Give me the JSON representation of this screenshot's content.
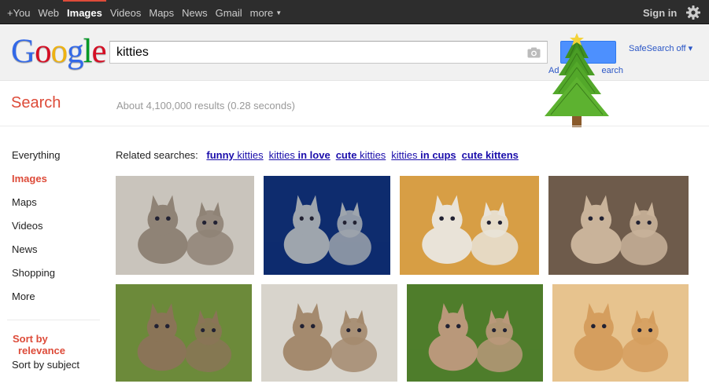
{
  "topnav": {
    "items": [
      {
        "label": "+You",
        "active": false
      },
      {
        "label": "Web",
        "active": false
      },
      {
        "label": "Images",
        "active": true
      },
      {
        "label": "Videos",
        "active": false
      },
      {
        "label": "Maps",
        "active": false
      },
      {
        "label": "News",
        "active": false
      },
      {
        "label": "Gmail",
        "active": false
      },
      {
        "label": "more",
        "active": false
      }
    ],
    "signin": "Sign in",
    "accent": "#dd4b39"
  },
  "header": {
    "logo_letters": [
      "G",
      "o",
      "o",
      "g",
      "l",
      "e"
    ],
    "logo_colors": [
      "#3369e8",
      "#d50f25",
      "#eeb211",
      "#3369e8",
      "#009925",
      "#d50f25"
    ],
    "query": "kitties",
    "advanced_search_visible": "Ad",
    "advanced_search_tail": "earch",
    "safesearch": "SafeSearch off ▾"
  },
  "results": {
    "section_label": "Search",
    "stats": "About 4,100,000 results (0.28 seconds)"
  },
  "sidebar": {
    "items": [
      {
        "label": "Everything",
        "active": false
      },
      {
        "label": "Images",
        "active": true
      },
      {
        "label": "Maps",
        "active": false
      },
      {
        "label": "Videos",
        "active": false
      },
      {
        "label": "News",
        "active": false
      },
      {
        "label": "Shopping",
        "active": false
      },
      {
        "label": "More",
        "active": false
      }
    ],
    "sort_relevance_1": "Sort by",
    "sort_relevance_2": "relevance",
    "sort_subject": "Sort by subject"
  },
  "related": {
    "prefix": "Related searches:",
    "links": [
      {
        "bold": "funny",
        "plain": "kitties",
        "bold_first": true
      },
      {
        "bold": "in love",
        "plain": "kitties",
        "bold_first": false
      },
      {
        "bold": "cute",
        "plain": "kitties",
        "bold_first": true
      },
      {
        "bold": "in cups",
        "plain": "kitties",
        "bold_first": false
      },
      {
        "bold": "cute kittens",
        "plain": "",
        "bold_first": true
      }
    ]
  },
  "images": [
    {
      "name": "kittens-in-sink",
      "bg": "#c9c4bc",
      "fg": "#8f8376"
    },
    {
      "name": "kittens-on-red",
      "bg": "#0e2c6e",
      "fg": "#9ea5ad"
    },
    {
      "name": "kittens-in-cups",
      "bg": "#d79e45",
      "fg": "#e9e3d8"
    },
    {
      "name": "kitten-collage",
      "bg": "#6e5b4b",
      "fg": "#c9b39a"
    },
    {
      "name": "tabby-kittens",
      "bg": "#6c8a3a",
      "fg": "#8a7457"
    },
    {
      "name": "kittens-row",
      "bg": "#d8d4cc",
      "fg": "#a48a6e"
    },
    {
      "name": "kittens-leaping",
      "bg": "#4f7d2b",
      "fg": "#b9987a"
    },
    {
      "name": "ginger-kittens-hug",
      "bg": "#e7c38e",
      "fg": "#d59e5e"
    }
  ]
}
